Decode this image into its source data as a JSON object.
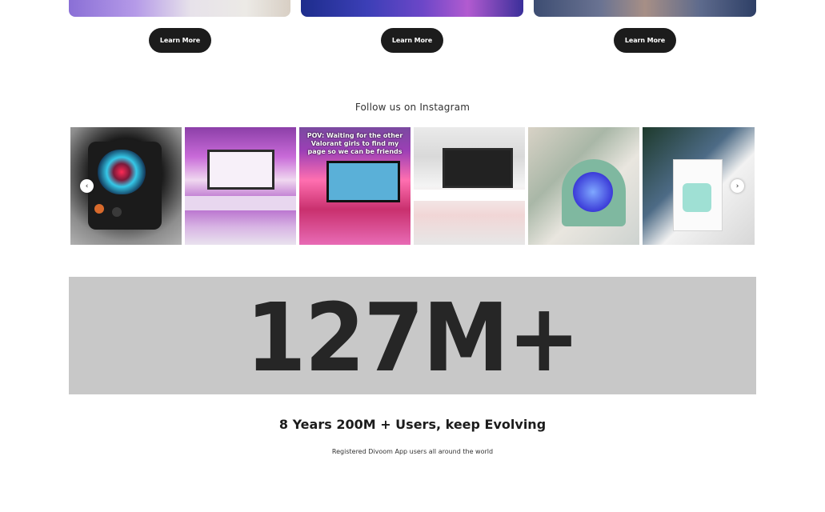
{
  "promo_cards": [
    {
      "button_label": "Learn More"
    },
    {
      "button_label": "Learn More"
    },
    {
      "button_label": "Learn More"
    }
  ],
  "instagram": {
    "heading": "Follow us on Instagram",
    "posts": [
      {
        "overlay_text": ""
      },
      {
        "overlay_text": ""
      },
      {
        "overlay_text": "POV: Waiting for the other Valorant girls to find my page so we can be friends"
      },
      {
        "overlay_text": ""
      },
      {
        "overlay_text": ""
      },
      {
        "overlay_text": ""
      }
    ],
    "prev_icon": "chevron-left-icon",
    "next_icon": "chevron-right-icon",
    "prev_glyph": "‹",
    "next_glyph": "›"
  },
  "stats": {
    "number": "127M+",
    "title": "8 Years 200M + Users, keep Evolving",
    "subtitle": "Registered Divoom App users all around the world",
    "band_color": "#c8c8c8"
  }
}
